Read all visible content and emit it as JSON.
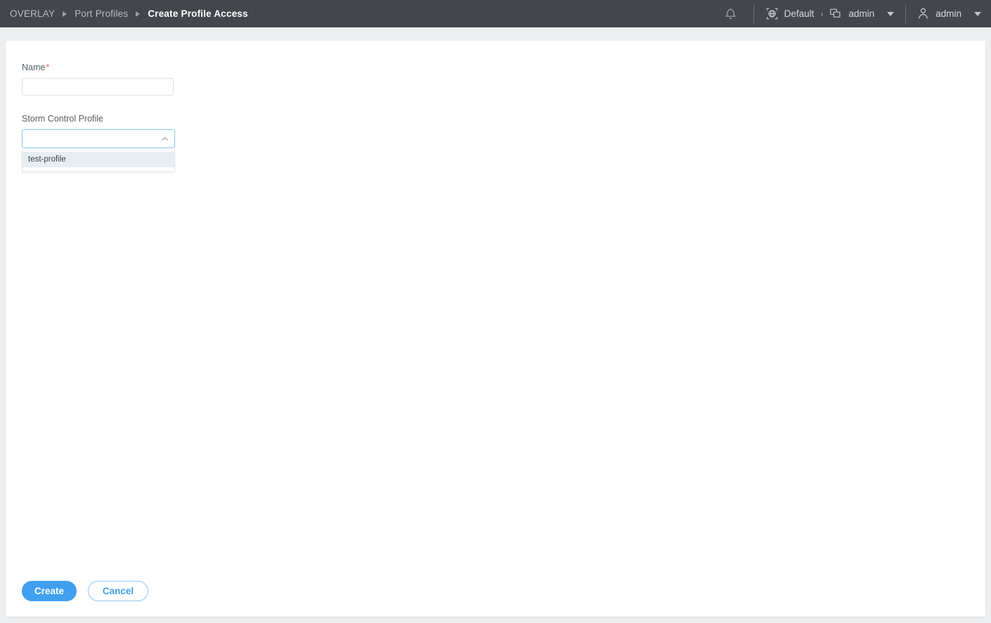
{
  "header": {
    "breadcrumb": [
      {
        "label": "OVERLAY",
        "active": false
      },
      {
        "label": "Port Profiles",
        "active": false
      },
      {
        "label": "Create Profile Access",
        "active": true
      }
    ],
    "notifications_icon": "bell-icon",
    "org": {
      "icon": "tenant-globe-icon",
      "label": "Default",
      "separator": "›"
    },
    "group": {
      "icon": "layers-group-icon",
      "label": "admin"
    },
    "user": {
      "icon": "user-icon",
      "label": "admin"
    }
  },
  "form": {
    "name_field": {
      "label": "Name",
      "required_marker": "*",
      "value": "",
      "placeholder": ""
    },
    "storm_control_field": {
      "label": "Storm Control Profile",
      "value": "",
      "chevron": "chevron-up-icon",
      "open": true,
      "options": [
        {
          "label": "test-profile",
          "highlighted": true
        }
      ]
    }
  },
  "actions": {
    "create_label": "Create",
    "cancel_label": "Cancel"
  },
  "colors": {
    "header_bg": "#43464c",
    "page_bg": "#eceef0",
    "card_bg": "#ffffff",
    "accent_blue": "#3fa0f0",
    "focus_border": "#86c5ef",
    "required_red": "#e8604c",
    "option_highlight": "#e7eef3"
  }
}
